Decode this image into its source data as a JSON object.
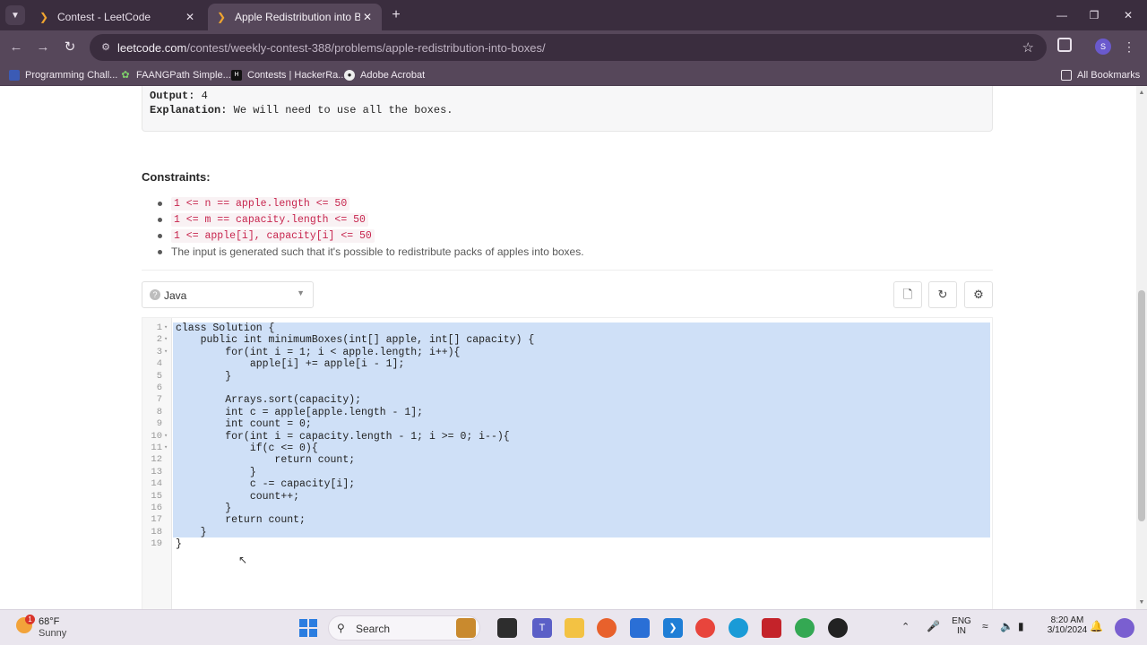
{
  "browser": {
    "tabs": [
      {
        "title": "Contest - LeetCode",
        "active": false
      },
      {
        "title": "Apple Redistribution into Boxe",
        "active": true
      }
    ],
    "url_host": "leetcode.com",
    "url_path": "/contest/weekly-contest-388/problems/apple-redistribution-into-boxes/",
    "profile_initial": "S",
    "bookmarks": [
      {
        "label": "Programming Chall..."
      },
      {
        "label": "FAANGPath Simple..."
      },
      {
        "label": "Contests | HackerRa..."
      },
      {
        "label": "Adobe Acrobat"
      }
    ],
    "all_bookmarks": "All Bookmarks"
  },
  "problem": {
    "output_label": "Output:",
    "output_value": "4",
    "explanation_label": "Explanation:",
    "explanation_value": "We will need to use all the boxes.",
    "constraints_title": "Constraints:",
    "constraints": [
      "1 <= n == apple.length <= 50",
      "1 <= m == capacity.length <= 50",
      "1 <= apple[i], capacity[i] <= 50",
      "The input is generated such that it's possible to redistribute packs of apples into boxes."
    ]
  },
  "editor": {
    "language": "Java",
    "code_lines": [
      "class Solution {",
      "    public int minimumBoxes(int[] apple, int[] capacity) {",
      "        for(int i = 1; i < apple.length; i++){",
      "            apple[i] += apple[i - 1];",
      "        }",
      "",
      "        Arrays.sort(capacity);",
      "        int c = apple[apple.length - 1];",
      "        int count = 0;",
      "        for(int i = capacity.length - 1; i >= 0; i--){",
      "            if(c <= 0){",
      "                return count;",
      "            }",
      "            c -= capacity[i];",
      "            count++;",
      "        }",
      "        return count;",
      "    }",
      "}"
    ],
    "line_numbers": [
      "1",
      "2",
      "3",
      "4",
      "5",
      "6",
      "7",
      "8",
      "9",
      "10",
      "11",
      "12",
      "13",
      "14",
      "15",
      "16",
      "17",
      "18",
      "19"
    ],
    "fold_lines": [
      1,
      2,
      3,
      10,
      11
    ]
  },
  "taskbar": {
    "weather_temp": "68°F",
    "weather_desc": "Sunny",
    "weather_badge": "1",
    "search_label": "Search",
    "lang_line1": "ENG",
    "lang_line2": "IN",
    "time": "8:20 AM",
    "date": "3/10/2024"
  },
  "colors": {
    "tab_bg": "#3a2d3e",
    "toolbar_bg": "#56475a",
    "selection": "#cfe0f7",
    "constraint_code": "#c7254e"
  }
}
